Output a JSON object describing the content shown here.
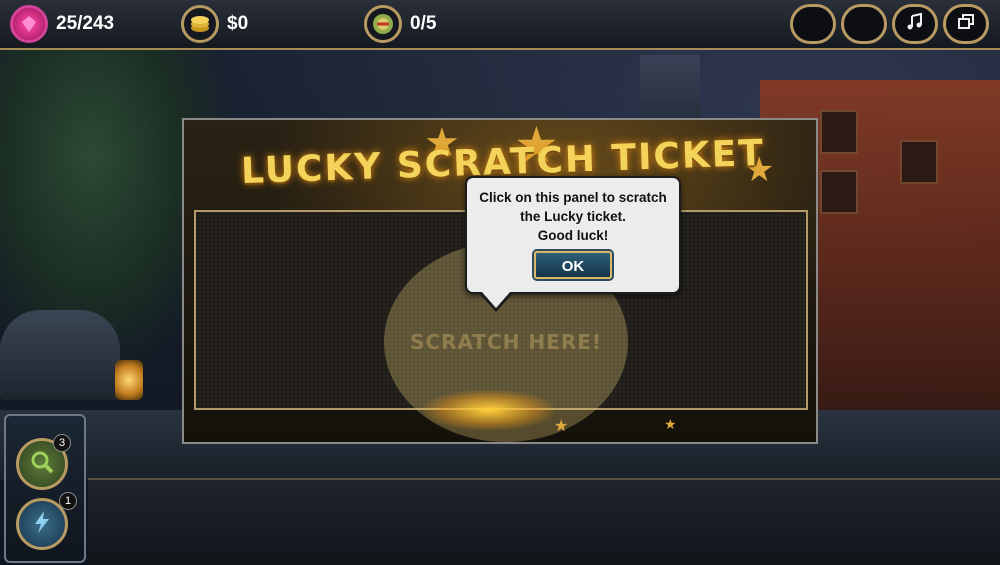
{
  "hud": {
    "progress": "25/243",
    "money": "$0",
    "collectibles": "0/5",
    "icons": [
      "pink-gem-icon",
      "coin-stack-icon",
      "badge-icon"
    ],
    "right_buttons": [
      "blank-button-1",
      "blank-button-2",
      "music-icon",
      "window-toggle-icon"
    ]
  },
  "ticket": {
    "title": "LUCKY SCRATCH TICKET",
    "scratch_label": "SCRATCH HERE!"
  },
  "popup": {
    "line1": "Click on this panel to scratch",
    "line2": "the Lucky ticket.",
    "line3": "Good luck!",
    "ok_label": "OK"
  },
  "tools": {
    "magnifier_count": "3",
    "lightning_count": "1"
  },
  "colors": {
    "accent_gold": "#b89a63",
    "title_gold": "#f3d35a",
    "ok_button": "#2e5f78"
  }
}
